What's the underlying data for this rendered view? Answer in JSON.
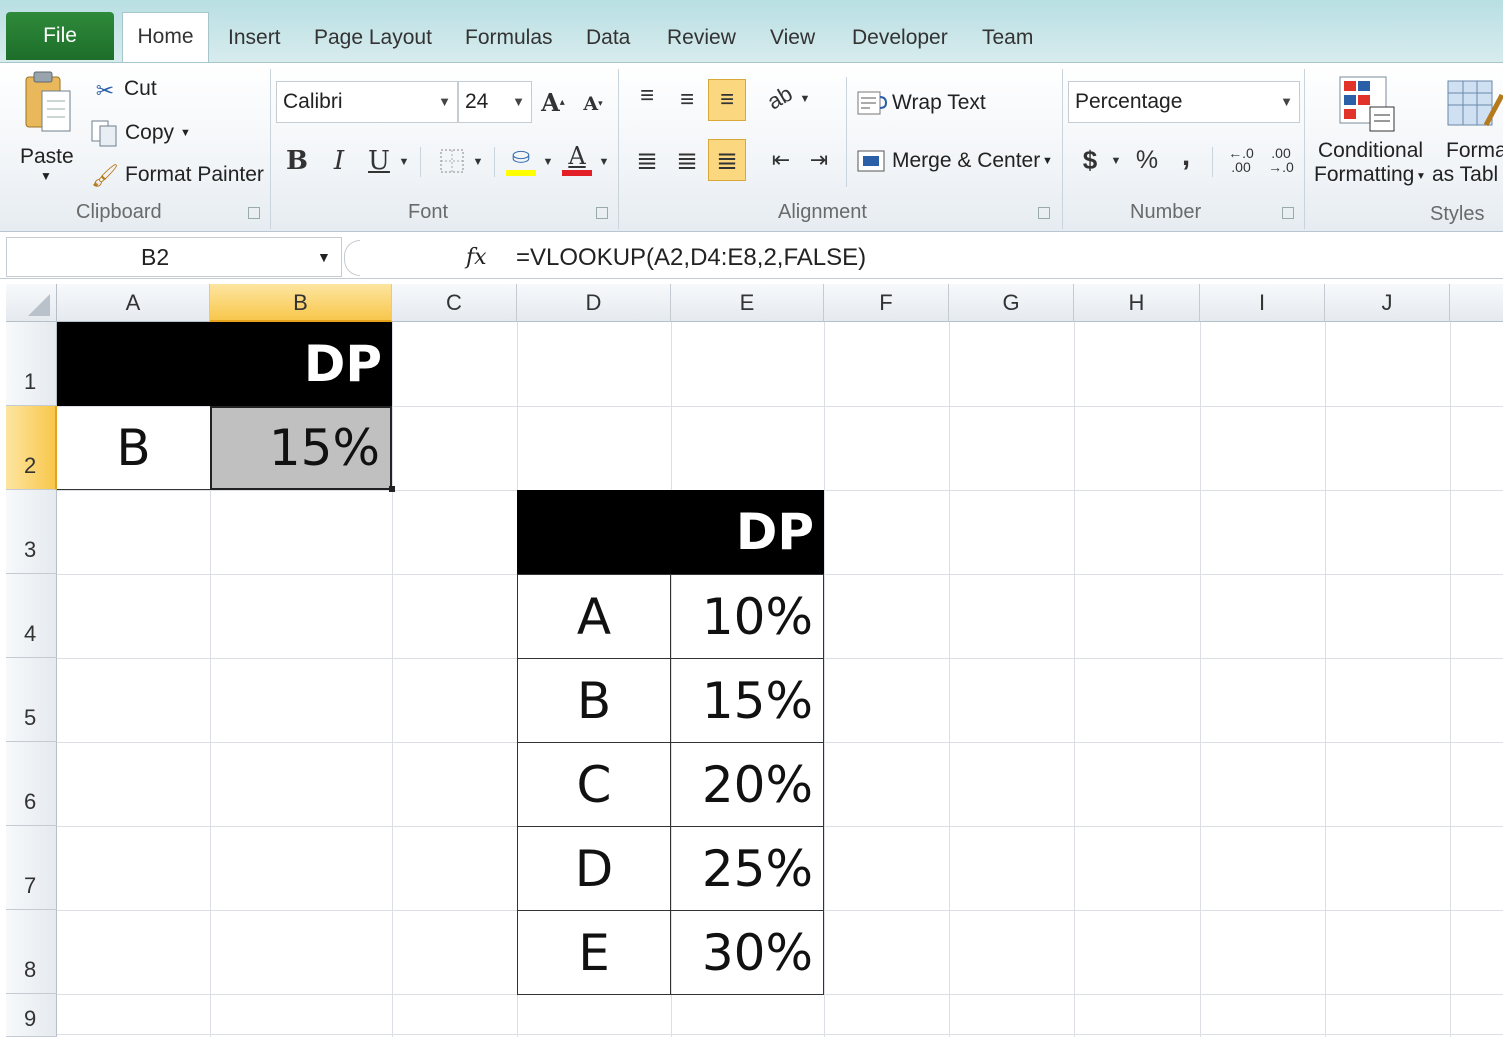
{
  "tabs": {
    "file": "File",
    "home": "Home",
    "insert": "Insert",
    "page_layout": "Page Layout",
    "formulas": "Formulas",
    "data": "Data",
    "review": "Review",
    "view": "View",
    "developer": "Developer",
    "team": "Team"
  },
  "clipboard": {
    "paste": "Paste",
    "cut": "Cut",
    "copy": "Copy",
    "format_painter": "Format Painter",
    "label": "Clipboard"
  },
  "font": {
    "name": "Calibri",
    "size": "24",
    "bold": "B",
    "italic": "I",
    "underline": "U",
    "font_color_glyph": "A",
    "label": "Font"
  },
  "alignment": {
    "wrap_text": "Wrap Text",
    "merge_center": "Merge & Center",
    "label": "Alignment"
  },
  "number": {
    "format": "Percentage",
    "currency": "$",
    "percent": "%",
    "comma": ",",
    "label": "Number"
  },
  "styles": {
    "conditional_line1": "Conditional",
    "conditional_line2": "Formatting",
    "format_table_line1": "Forma",
    "format_table_line2": "as Tabl",
    "label": "Styles"
  },
  "formula_bar": {
    "name_box": "B2",
    "fx": "fx",
    "formula": "=VLOOKUP(A2,D4:E8,2,FALSE)"
  },
  "grid": {
    "columns": [
      "A",
      "B",
      "C",
      "D",
      "E",
      "F",
      "G",
      "H",
      "I",
      "J"
    ],
    "rows": [
      "1",
      "2",
      "3",
      "4",
      "5",
      "6",
      "7",
      "8",
      "9"
    ],
    "selected_cell": "B2",
    "lookup": {
      "header": "DP",
      "key": "B",
      "result": "15%"
    },
    "table": {
      "header": "DP",
      "rows": [
        {
          "code": "A",
          "dp": "10%"
        },
        {
          "code": "B",
          "dp": "15%"
        },
        {
          "code": "C",
          "dp": "20%"
        },
        {
          "code": "D",
          "dp": "25%"
        },
        {
          "code": "E",
          "dp": "30%"
        }
      ]
    }
  },
  "colors": {
    "file_tab": "#1d6e2a",
    "selection_header": "#f8c74c",
    "selected_cell_fill": "#c0c0c0",
    "header_black": "#000000"
  }
}
